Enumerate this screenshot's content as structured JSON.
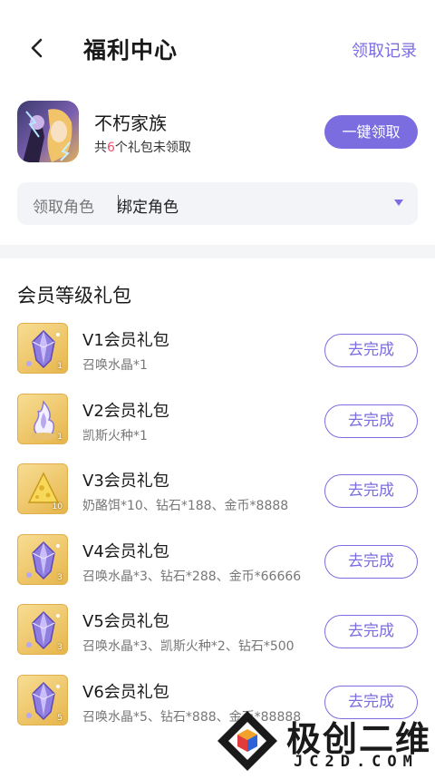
{
  "header": {
    "title": "福利中心",
    "records_label": "领取记录"
  },
  "game": {
    "name": "不朽家族",
    "pending_prefix": "共",
    "pending_count": "6",
    "pending_suffix": "个礼包未领取",
    "claim_all_label": "一键领取"
  },
  "role_select": {
    "label": "领取角色",
    "value": "绑定角色"
  },
  "section": {
    "title": "会员等级礼包"
  },
  "gifts": [
    {
      "name": "V1会员礼包",
      "desc": "召唤水晶*1",
      "icon": "crystal-icon",
      "count": "1",
      "button": "去完成"
    },
    {
      "name": "V2会员礼包",
      "desc": "凯斯火种*1",
      "icon": "flame-icon",
      "count": "1",
      "button": "去完成"
    },
    {
      "name": "V3会员礼包",
      "desc": "奶酪饵*10、钻石*188、金币*8888",
      "icon": "cheese-icon",
      "count": "10",
      "button": "去完成"
    },
    {
      "name": "V4会员礼包",
      "desc": "召唤水晶*3、钻石*288、金币*66666",
      "icon": "crystal-icon",
      "count": "3",
      "button": "去完成"
    },
    {
      "name": "V5会员礼包",
      "desc": "召唤水晶*3、凯斯火种*2、钻石*500",
      "icon": "crystal-icon",
      "count": "3",
      "button": "去完成"
    },
    {
      "name": "V6会员礼包",
      "desc": "召唤水晶*5、钻石*888、金币*88888",
      "icon": "crystal-icon",
      "count": "5",
      "button": "去完成"
    }
  ],
  "watermark": {
    "text": "极创二维",
    "sub": "JC2D.COM"
  },
  "colors": {
    "accent": "#7b6de0",
    "highlight": "#f0506e"
  }
}
